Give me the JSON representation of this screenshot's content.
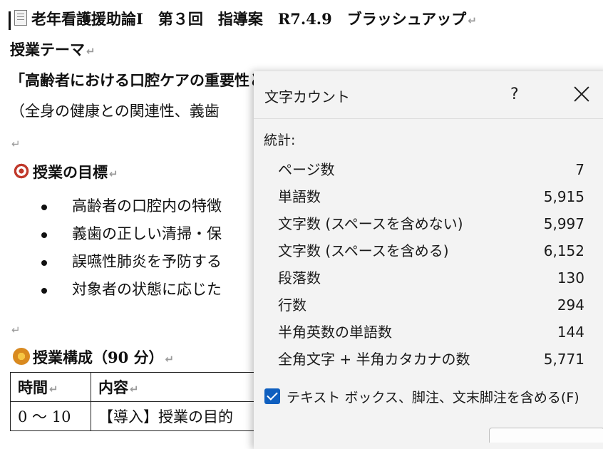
{
  "document": {
    "title": "老年看護援助論Ⅰ　第３回　指導案　R7.4.9　ブラッシュアップ",
    "theme_heading": "授業テーマ",
    "theme_title": "「高齢者における口腔ケアの重要性と実践技術」",
    "theme_sub": "（全身の健康との関連性、義歯",
    "goals_heading": "授業の目標",
    "goals": [
      "高齢者の口腔内の特徴",
      "義歯の正しい清掃・保",
      "誤嚥性肺炎を予防する",
      "対象者の状態に応じた"
    ],
    "structure_heading": "授業構成（90 分）",
    "table": {
      "headers": [
        "時間",
        "内容"
      ],
      "rows": [
        [
          "0 ～ 10",
          "【導入】授業の目的"
        ]
      ]
    }
  },
  "dialog": {
    "title": "文字カウント",
    "help": "?",
    "stats_label": "統計:",
    "stats": [
      {
        "label": "ページ数",
        "value": "7"
      },
      {
        "label": "単語数",
        "value": "5,915"
      },
      {
        "label": "文字数 (スペースを含めない)",
        "value": "5,997"
      },
      {
        "label": "文字数 (スペースを含める)",
        "value": "6,152"
      },
      {
        "label": "段落数",
        "value": "130"
      },
      {
        "label": "行数",
        "value": "294"
      },
      {
        "label": "半角英数の単語数",
        "value": "144"
      },
      {
        "label": "全角文字 + 半角カタカナの数",
        "value": "5,771"
      }
    ],
    "checkbox_label": "テキスト ボックス、脚注、文末脚注を含める(F)",
    "checkbox_checked": true
  },
  "colors": {
    "accent": "#0f5fbf",
    "dialog_bg": "#f3f3f3"
  }
}
